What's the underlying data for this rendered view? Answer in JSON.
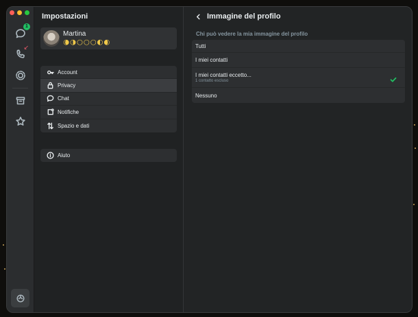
{
  "settings": {
    "title": "Impostazioni",
    "profile": {
      "name": "Martina",
      "status": "🌘🌗🌕🌕🌕🌓🌒"
    },
    "menu": [
      {
        "label": "Account",
        "icon": "key-icon",
        "active": false
      },
      {
        "label": "Privacy",
        "icon": "lock-icon",
        "active": true
      },
      {
        "label": "Chat",
        "icon": "chat-bubble-icon",
        "active": false
      },
      {
        "label": "Notifiche",
        "icon": "notification-icon",
        "active": false
      },
      {
        "label": "Spazio e dati",
        "icon": "storage-arrows-icon",
        "active": false
      }
    ],
    "help": {
      "label": "Aiuto",
      "icon": "info-icon"
    }
  },
  "rail": {
    "chats_badge": "1",
    "icons": [
      "chats-icon",
      "calls-icon",
      "status-icon",
      "archive-icon",
      "starred-icon",
      "meta-ai-icon"
    ]
  },
  "detail": {
    "title": "Immagine del profilo",
    "section_label": "Chi può vedere la mia immagine del profilo",
    "options": [
      {
        "label": "Tutti",
        "sub": "",
        "selected": false
      },
      {
        "label": "I miei contatti",
        "sub": "",
        "selected": false
      },
      {
        "label": "I miei contatti eccetto...",
        "sub": "1 contatto escluso",
        "selected": true
      },
      {
        "label": "Nessuno",
        "sub": "",
        "selected": false
      }
    ]
  },
  "colors": {
    "accent": "#21c063",
    "missed_call": "#f15c6d",
    "selected_row": "#3b3d40"
  }
}
